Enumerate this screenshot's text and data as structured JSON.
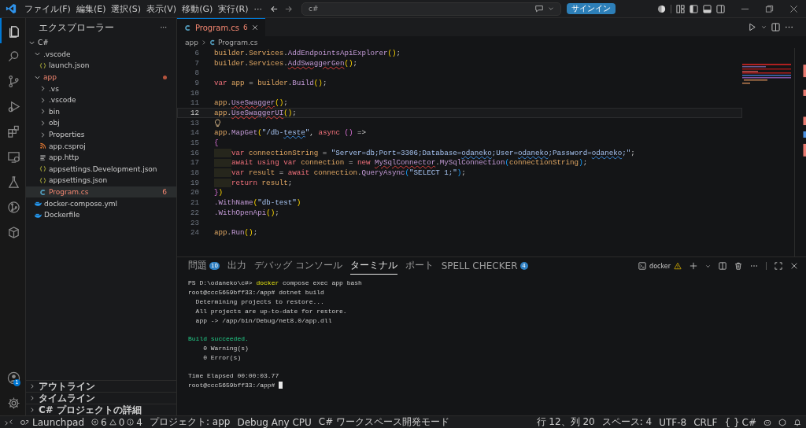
{
  "title_bar": {
    "menus": [
      "ファイル(F)",
      "編集(E)",
      "選択(S)",
      "表示(V)",
      "移動(G)",
      "実行(R)"
    ],
    "menu_more": "···",
    "search": {
      "value": "c#"
    },
    "sign_in": "サインイン"
  },
  "activity_bar": {
    "items": [
      {
        "selected": true
      },
      {
        "selected": false
      },
      {
        "selected": false
      },
      {
        "selected": false
      },
      {
        "selected": false
      },
      {
        "selected": false
      },
      {
        "selected": false
      },
      {
        "selected": false
      },
      {
        "selected": false
      }
    ],
    "account_badge": "1"
  },
  "explorer": {
    "title": "エクスプローラー",
    "more": "···",
    "tree": [
      {
        "label": "C#",
        "kind": "folder",
        "expanded": true,
        "selected": false,
        "error": false,
        "children": [
          {
            "label": ".vscode",
            "kind": "folder",
            "expanded": true,
            "selected": false,
            "error": false,
            "children": [
              {
                "label": "launch.json",
                "kind": "json",
                "selected": false,
                "error": false
              }
            ]
          },
          {
            "label": "app",
            "kind": "folder",
            "expanded": true,
            "selected": false,
            "error": true,
            "dot": true,
            "children": [
              {
                "label": ".vs",
                "kind": "folder",
                "expanded": false,
                "selected": false,
                "error": false
              },
              {
                "label": ".vscode",
                "kind": "folder",
                "expanded": false,
                "selected": false,
                "error": false
              },
              {
                "label": "bin",
                "kind": "folder",
                "expanded": false,
                "selected": false,
                "error": false
              },
              {
                "label": "obj",
                "kind": "folder",
                "expanded": false,
                "selected": false,
                "error": false
              },
              {
                "label": "Properties",
                "kind": "folder",
                "expanded": false,
                "selected": false,
                "error": false
              },
              {
                "label": "app.csproj",
                "kind": "project",
                "selected": false,
                "error": false
              },
              {
                "label": "app.http",
                "kind": "text",
                "selected": false,
                "error": false
              },
              {
                "label": "appsettings.Development.json",
                "kind": "json",
                "selected": false,
                "error": false
              },
              {
                "label": "appsettings.json",
                "kind": "json",
                "selected": false,
                "error": false
              },
              {
                "label": "Program.cs",
                "kind": "csharp",
                "selected": true,
                "error": true,
                "badge": "6"
              }
            ]
          },
          {
            "label": "docker-compose.yml",
            "kind": "docker",
            "selected": false,
            "error": false
          },
          {
            "label": "Dockerfile",
            "kind": "docker",
            "selected": false,
            "error": false
          }
        ]
      }
    ],
    "sections": [
      {
        "label": "アウトライン",
        "expanded": false
      },
      {
        "label": "タイムライン",
        "expanded": false
      },
      {
        "label": "C# プロジェクトの詳細",
        "expanded": false
      }
    ]
  },
  "editor": {
    "tab": {
      "label": "Program.cs",
      "badge": "6",
      "selected": true,
      "error": true
    },
    "breadcrumb": [
      "app",
      "Program.cs"
    ],
    "lines": [
      {
        "number": "6",
        "current": false,
        "lightbulb": false,
        "indented": false,
        "tokens": [
          {
            "text": "builder",
            "kind": "var"
          },
          {
            "text": ".",
            "kind": "op"
          },
          {
            "text": "Services",
            "kind": "var"
          },
          {
            "text": ".",
            "kind": "op"
          },
          {
            "text": "AddEndpointsApiExplorer",
            "kind": "fn"
          },
          {
            "text": "()",
            "kind": "br1"
          },
          {
            "text": ";",
            "kind": "op"
          }
        ]
      },
      {
        "number": "7",
        "current": false,
        "lightbulb": false,
        "indented": false,
        "tokens": [
          {
            "text": "builder",
            "kind": "var"
          },
          {
            "text": ".",
            "kind": "op"
          },
          {
            "text": "Services",
            "kind": "var"
          },
          {
            "text": ".",
            "kind": "op"
          },
          {
            "text": "AddSwaggerGen",
            "kind": "fn",
            "error": true
          },
          {
            "text": "()",
            "kind": "br1"
          },
          {
            "text": ";",
            "kind": "op"
          }
        ]
      },
      {
        "number": "8",
        "current": false,
        "lightbulb": false,
        "indented": false
      },
      {
        "number": "9",
        "current": false,
        "lightbulb": false,
        "indented": false,
        "tokens": [
          {
            "text": "var",
            "kind": "kw"
          },
          {
            "text": " app ",
            "kind": "var"
          },
          {
            "text": "= ",
            "kind": "op"
          },
          {
            "text": "builder",
            "kind": "var"
          },
          {
            "text": ".",
            "kind": "op"
          },
          {
            "text": "Build",
            "kind": "fn"
          },
          {
            "text": "()",
            "kind": "br1"
          },
          {
            "text": ";",
            "kind": "op"
          }
        ]
      },
      {
        "number": "10",
        "current": false,
        "lightbulb": false,
        "indented": false
      },
      {
        "number": "11",
        "current": false,
        "lightbulb": false,
        "indented": false,
        "tokens": [
          {
            "text": "app",
            "kind": "var"
          },
          {
            "text": ".",
            "kind": "op"
          },
          {
            "text": "UseSwagger",
            "kind": "fn",
            "error": true
          },
          {
            "text": "()",
            "kind": "br1"
          },
          {
            "text": ";",
            "kind": "op"
          }
        ]
      },
      {
        "number": "12",
        "current": true,
        "lightbulb": false,
        "indented": false,
        "tokens": [
          {
            "text": "app",
            "kind": "var"
          },
          {
            "text": ".",
            "kind": "op"
          },
          {
            "text": "UseSwaggerUI",
            "kind": "fn",
            "error": true
          },
          {
            "text": "()",
            "kind": "br1"
          },
          {
            "text": ";",
            "kind": "op"
          }
        ]
      },
      {
        "number": "13",
        "current": false,
        "lightbulb": true,
        "indented": false
      },
      {
        "number": "14",
        "current": false,
        "lightbulb": false,
        "indented": false,
        "tokens": [
          {
            "text": "app",
            "kind": "var"
          },
          {
            "text": ".",
            "kind": "op"
          },
          {
            "text": "MapGet",
            "kind": "fn"
          },
          {
            "text": "(",
            "kind": "br1"
          },
          {
            "text": "\"/db-",
            "kind": "str"
          },
          {
            "text": "teste",
            "kind": "str",
            "spelling": true
          },
          {
            "text": "\"",
            "kind": "str"
          },
          {
            "text": ", ",
            "kind": "op"
          },
          {
            "text": "async ",
            "kind": "kw"
          },
          {
            "text": "()",
            "kind": "br2"
          },
          {
            "text": " =>",
            "kind": "op"
          }
        ]
      },
      {
        "number": "15",
        "current": false,
        "lightbulb": false,
        "indented": false,
        "tokens": [
          {
            "text": "{",
            "kind": "br2"
          }
        ]
      },
      {
        "number": "16",
        "current": false,
        "lightbulb": false,
        "indented": true,
        "tokens": [
          {
            "text": "var",
            "kind": "kw"
          },
          {
            "text": " connectionString ",
            "kind": "var"
          },
          {
            "text": "= ",
            "kind": "op"
          },
          {
            "text": "\"Server=db;Port=3306;Database=",
            "kind": "str"
          },
          {
            "text": "odaneko",
            "kind": "str",
            "spelling": true
          },
          {
            "text": ";User=",
            "kind": "str"
          },
          {
            "text": "odaneko",
            "kind": "str",
            "spelling": true
          },
          {
            "text": ";Password=",
            "kind": "str"
          },
          {
            "text": "odaneko",
            "kind": "str",
            "spelling": true
          },
          {
            "text": ";\"",
            "kind": "str"
          },
          {
            "text": ";",
            "kind": "op"
          }
        ]
      },
      {
        "number": "17",
        "current": false,
        "lightbulb": false,
        "indented": true,
        "tokens": [
          {
            "text": "await using var",
            "kind": "kw"
          },
          {
            "text": " connection ",
            "kind": "var"
          },
          {
            "text": "= ",
            "kind": "op"
          },
          {
            "text": "new ",
            "kind": "kw"
          },
          {
            "text": "MySqlConnector",
            "kind": "fn",
            "error": true
          },
          {
            "text": ".",
            "kind": "op"
          },
          {
            "text": "MySqlConnection",
            "kind": "fn"
          },
          {
            "text": "(",
            "kind": "br3"
          },
          {
            "text": "connectionString",
            "kind": "var"
          },
          {
            "text": ")",
            "kind": "br3"
          },
          {
            "text": ";",
            "kind": "op"
          }
        ]
      },
      {
        "number": "18",
        "current": false,
        "lightbulb": false,
        "indented": true,
        "tokens": [
          {
            "text": "var",
            "kind": "kw"
          },
          {
            "text": " result ",
            "kind": "var"
          },
          {
            "text": "= ",
            "kind": "op"
          },
          {
            "text": "await",
            "kind": "kw"
          },
          {
            "text": " connection",
            "kind": "var"
          },
          {
            "text": ".",
            "kind": "op"
          },
          {
            "text": "QueryAsync",
            "kind": "fn"
          },
          {
            "text": "(",
            "kind": "br3"
          },
          {
            "text": "\"SELECT 1;\"",
            "kind": "str"
          },
          {
            "text": ")",
            "kind": "br3"
          },
          {
            "text": ";",
            "kind": "op"
          }
        ]
      },
      {
        "number": "19",
        "current": false,
        "lightbulb": false,
        "indented": true,
        "tokens": [
          {
            "text": "return",
            "kind": "kw"
          },
          {
            "text": " result",
            "kind": "var"
          },
          {
            "text": ";",
            "kind": "op"
          }
        ]
      },
      {
        "number": "20",
        "current": false,
        "lightbulb": false,
        "indented": false,
        "tokens": [
          {
            "text": "}",
            "kind": "br2"
          },
          {
            "text": ")",
            "kind": "br1"
          }
        ]
      },
      {
        "number": "21",
        "current": false,
        "lightbulb": false,
        "indented": false,
        "tokens": [
          {
            "text": ".WithName",
            "kind": "fn"
          },
          {
            "text": "(",
            "kind": "br1"
          },
          {
            "text": "\"db-test\"",
            "kind": "str"
          },
          {
            "text": ")",
            "kind": "br1"
          }
        ]
      },
      {
        "number": "22",
        "current": false,
        "lightbulb": false,
        "indented": false,
        "tokens": [
          {
            "text": ".WithOpenApi",
            "kind": "fn"
          },
          {
            "text": "()",
            "kind": "br1"
          },
          {
            "text": ";",
            "kind": "op"
          }
        ]
      },
      {
        "number": "23",
        "current": false,
        "lightbulb": false,
        "indented": false
      },
      {
        "number": "24",
        "current": false,
        "lightbulb": false,
        "indented": false,
        "tokens": [
          {
            "text": "app",
            "kind": "var"
          },
          {
            "text": ".",
            "kind": "op"
          },
          {
            "text": "Run",
            "kind": "fn"
          },
          {
            "text": "()",
            "kind": "br1"
          },
          {
            "text": ";",
            "kind": "op"
          }
        ]
      }
    ]
  },
  "panel": {
    "tabs": [
      {
        "label": "問題",
        "badge": "10",
        "selected": false
      },
      {
        "label": "出力",
        "selected": false
      },
      {
        "label": "デバッグ コンソール",
        "selected": false
      },
      {
        "label": "ターミナル",
        "selected": true
      },
      {
        "label": "ポート",
        "selected": false
      },
      {
        "label": "SPELL CHECKER",
        "badge": "4",
        "selected": false
      }
    ],
    "terminal_name": "docker",
    "terminal": [
      {
        "cursor": false,
        "segments": [
          {
            "text": "PS D:\\odaneko\\c#> ",
            "kind": "plain"
          },
          {
            "text": "docker",
            "kind": "command"
          },
          {
            "text": " compose exec app bash",
            "kind": "plain"
          }
        ]
      },
      {
        "cursor": false,
        "segments": [
          {
            "text": "root@ccc5659bff33:/app# dotnet build",
            "kind": "plain"
          }
        ]
      },
      {
        "cursor": false,
        "segments": [
          {
            "text": "  Determining projects to restore...",
            "kind": "plain"
          }
        ]
      },
      {
        "cursor": false,
        "segments": [
          {
            "text": "  All projects are up-to-date for restore.",
            "kind": "plain"
          }
        ]
      },
      {
        "cursor": false,
        "segments": [
          {
            "text": "  app -> /app/bin/Debug/net8.0/app.dll",
            "kind": "plain"
          }
        ]
      },
      {
        "cursor": false
      },
      {
        "cursor": false,
        "segments": [
          {
            "text": "Build succeeded.",
            "kind": "success"
          }
        ]
      },
      {
        "cursor": false,
        "segments": [
          {
            "text": "    0 Warning(s)",
            "kind": "plain"
          }
        ]
      },
      {
        "cursor": false,
        "segments": [
          {
            "text": "    0 Error(s)",
            "kind": "plain"
          }
        ]
      },
      {
        "cursor": false
      },
      {
        "cursor": false,
        "segments": [
          {
            "text": "Time Elapsed 00:00:03.77",
            "kind": "plain"
          }
        ]
      },
      {
        "cursor": true,
        "segments": [
          {
            "text": "root@ccc5659bff33:/app# ",
            "kind": "plain"
          }
        ]
      }
    ]
  },
  "status_bar": {
    "launchpad": "Launchpad",
    "errors": "6",
    "warnings": "0",
    "infos": "4",
    "left": [
      "プロジェクト: app",
      "Debug Any CPU",
      "C# ワークスペース開発モード"
    ],
    "right": [
      "行 12、列 20",
      "スペース: 4",
      "UTF-8",
      "CRLF"
    ],
    "language_icon": "{ }",
    "language": "C#"
  }
}
